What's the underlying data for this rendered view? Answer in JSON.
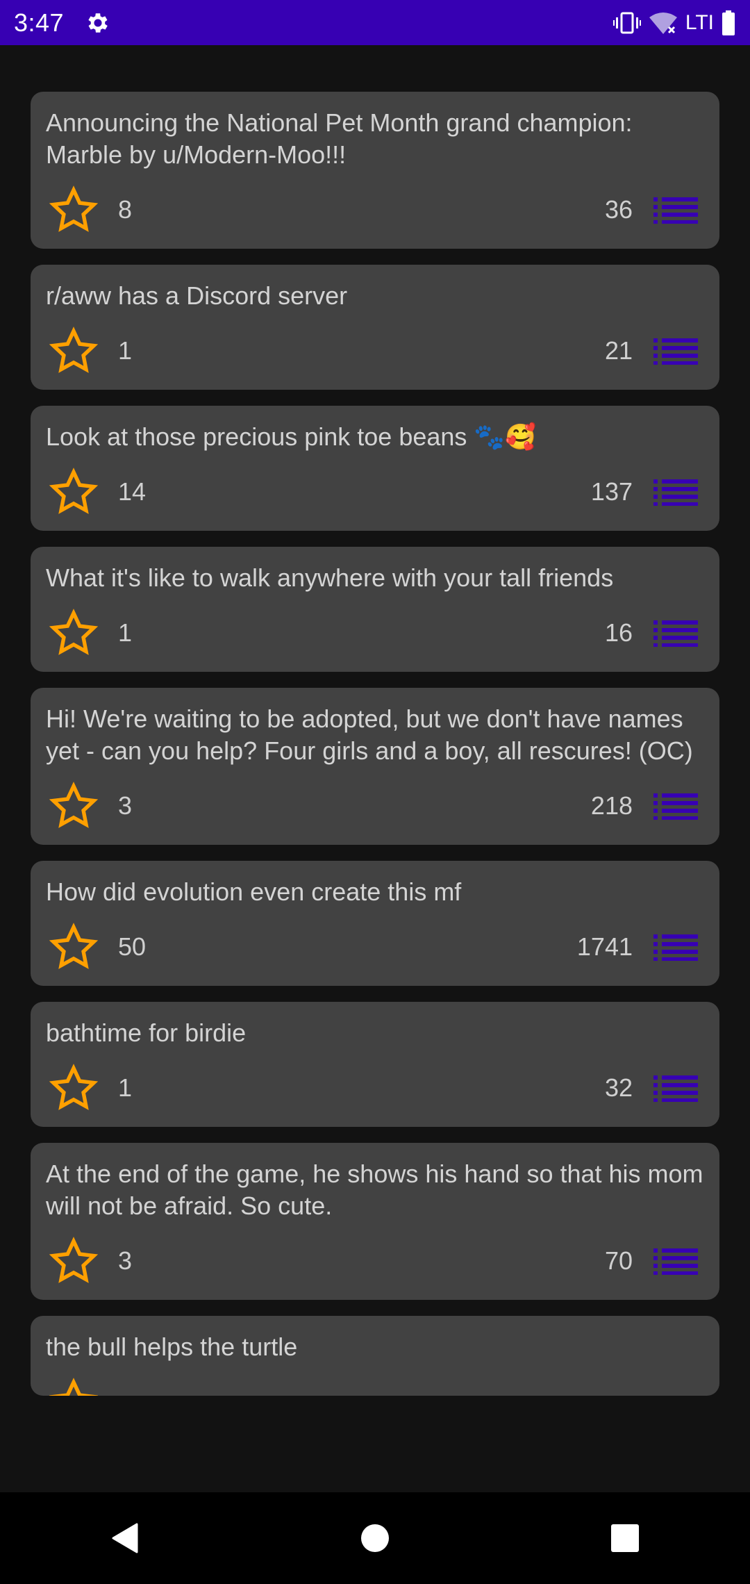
{
  "status_bar": {
    "time": "3:47",
    "carrier": "LTI",
    "icons": [
      "gear-icon",
      "vibrate-icon",
      "wifi-off-icon",
      "battery-icon"
    ]
  },
  "colors": {
    "accent": "#3700b3",
    "star": "#ffa000",
    "card": "#424242",
    "background": "#121212"
  },
  "posts": [
    {
      "title": "Announcing the National Pet Month grand champion: Marble by u/Modern-Moo!!!",
      "stars": "8",
      "comments": "36"
    },
    {
      "title": "r/aww has a Discord server",
      "stars": "1",
      "comments": "21"
    },
    {
      "title": "Look at those precious pink toe beans 🐾🥰",
      "stars": "14",
      "comments": "137"
    },
    {
      "title": "What it's like to walk anywhere with your tall friends",
      "stars": "1",
      "comments": "16"
    },
    {
      "title": "Hi! We're waiting to be adopted, but we don't have names yet - can you help? Four girls and a boy, all rescures! (OC)",
      "stars": "3",
      "comments": "218"
    },
    {
      "title": "How did evolution even create this mf",
      "stars": "50",
      "comments": "1741"
    },
    {
      "title": "bathtime for birdie",
      "stars": "1",
      "comments": "32"
    },
    {
      "title": "At the end of the game, he shows his hand so that his mom will not be afraid. So cute.",
      "stars": "3",
      "comments": "70"
    },
    {
      "title": "the bull helps the turtle"
    }
  ],
  "nav": [
    "back-icon",
    "home-icon",
    "recents-icon"
  ]
}
